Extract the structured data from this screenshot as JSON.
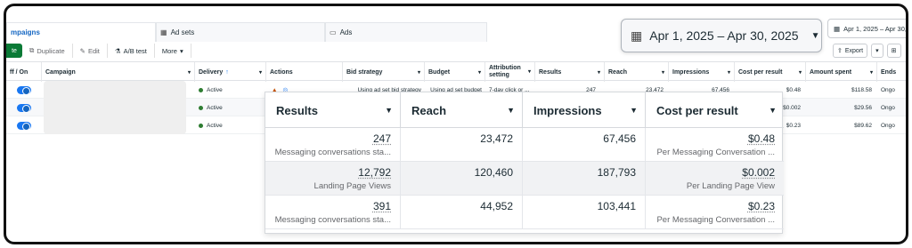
{
  "tabs": {
    "campaigns": "mpaigns",
    "adsets": "Ad sets",
    "ads": "Ads"
  },
  "toolbar": {
    "create": "te",
    "duplicate": "Duplicate",
    "edit": "Edit",
    "ab_test": "A/B test",
    "more": "More"
  },
  "date_range": {
    "big": "Apr 1, 2025 – Apr 30, 2025",
    "small": "Apr 1, 2025 – Apr 30, 2025"
  },
  "export_label": "Export",
  "columns": {
    "onoff": "ff / On",
    "campaign": "Campaign",
    "delivery": "Delivery",
    "actions": "Actions",
    "bid": "Bid strategy",
    "budget": "Budget",
    "attribution": "Attribution setting",
    "results": "Results",
    "reach": "Reach",
    "impressions": "Impressions",
    "cpr": "Cost per result",
    "spent": "Amount spent",
    "ends": "Ends"
  },
  "rows": [
    {
      "delivery": "Active",
      "bid": "Using ad set bid strategy",
      "budget": "Using ad set budget",
      "attribution": "7-day click or ...",
      "results": "247",
      "results_sub": "Messaging conversations sta...",
      "reach": "23,472",
      "impressions": "67,456",
      "cpr": "$0.48",
      "cpr_sub": "Per Messaging Conversation ...",
      "spent": "$118.58",
      "ends": "Ongo"
    },
    {
      "delivery": "Active",
      "results": "12,792",
      "results_sub": "Landing Page Views",
      "reach": "120,460",
      "impressions": "187,793",
      "cpr": "$0.002",
      "cpr_sub": "Per Landing Page View",
      "spent": "$29.56",
      "ends": "Ongo"
    },
    {
      "delivery": "Active",
      "results": "391",
      "results_sub": "Messaging conversations sta...",
      "reach": "44,952",
      "impressions": "103,441",
      "cpr": "$0.23",
      "cpr_sub": "Per Messaging Conversation ...",
      "spent": "$89.62",
      "ends": "Ongo"
    }
  ]
}
